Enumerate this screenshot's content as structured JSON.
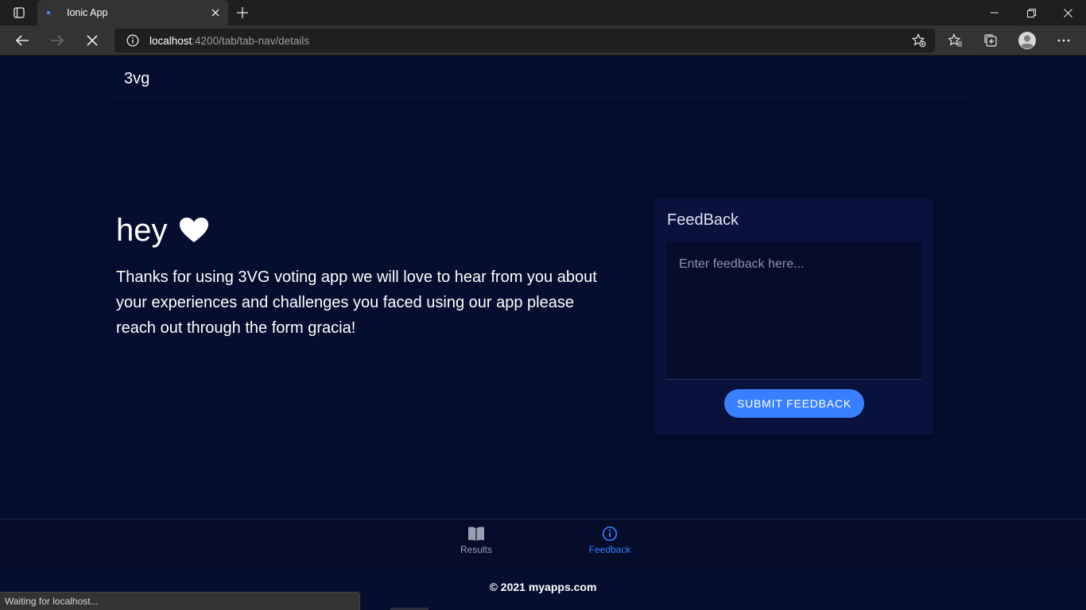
{
  "browser": {
    "tab_title": "Ionic App",
    "url_host": "localhost",
    "url_rest": ":4200/tab/tab-nav/details",
    "status_text": "Waiting for localhost..."
  },
  "header": {
    "brand": "3vg"
  },
  "hero": {
    "greeting": "hey",
    "icon": "heart-icon",
    "message": "Thanks for using 3VG voting app we will love to hear from you about your experiences and challenges you faced using our app please reach out through the form gracia!"
  },
  "feedback_card": {
    "title": "FeedBack",
    "placeholder": "Enter feedback here...",
    "value": "",
    "submit_label": "SUBMIT FEEDBACK"
  },
  "tabs": [
    {
      "label": "Results",
      "icon": "book-icon",
      "active": false
    },
    {
      "label": "Feedback",
      "icon": "info-icon",
      "active": true
    }
  ],
  "footer": {
    "text": "© 2021 myapps.com"
  },
  "colors": {
    "page_bg": "#050e2f",
    "card_bg": "#08123d",
    "accent": "#3880ff",
    "inactive_tab": "#9aa0b3"
  }
}
